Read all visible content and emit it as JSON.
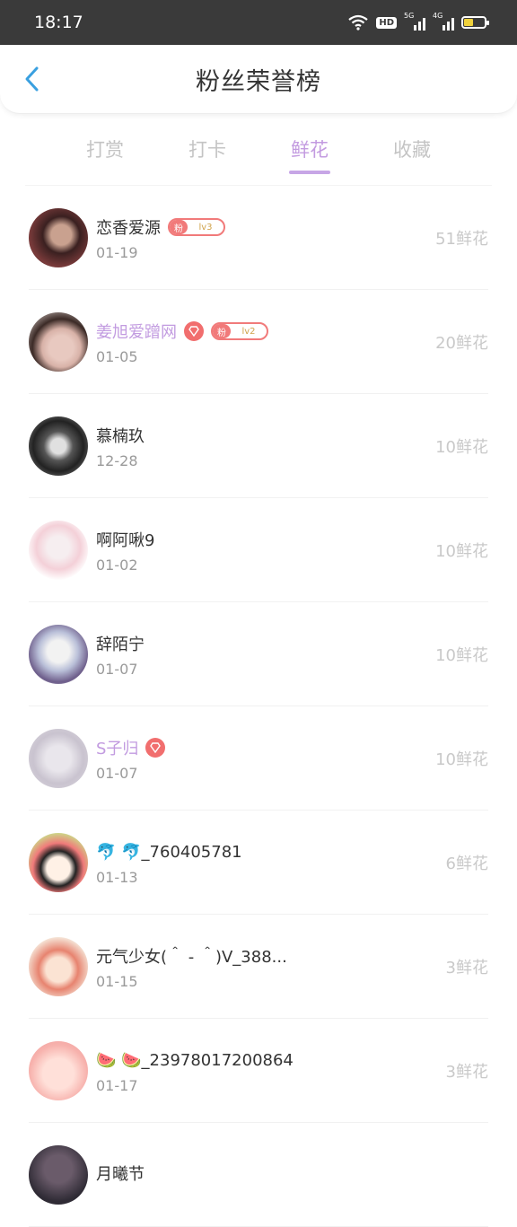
{
  "status": {
    "time": "18:17",
    "hd": "HD",
    "sig1": "5G",
    "sig2": "4G"
  },
  "header": {
    "title": "粉丝荣誉榜"
  },
  "tabs": [
    {
      "label": "打赏",
      "active": false
    },
    {
      "label": "打卡",
      "active": false
    },
    {
      "label": "鲜花",
      "active": true
    },
    {
      "label": "收藏",
      "active": false
    }
  ],
  "badge_prefix": "粉",
  "rows": [
    {
      "name": "恋香爱源",
      "date": "01-19",
      "count": "51鲜花",
      "vip": false,
      "level": "lv3"
    },
    {
      "name": "姜旭爱蹭网",
      "date": "01-05",
      "count": "20鲜花",
      "vip": true,
      "level": "lv2"
    },
    {
      "name": "慕楠玖",
      "date": "12-28",
      "count": "10鲜花",
      "vip": false,
      "level": ""
    },
    {
      "name": "啊阿啾9",
      "date": "01-02",
      "count": "10鲜花",
      "vip": false,
      "level": ""
    },
    {
      "name": "辞陌宁",
      "date": "01-07",
      "count": "10鲜花",
      "vip": false,
      "level": ""
    },
    {
      "name": "S子归",
      "date": "01-07",
      "count": "10鲜花",
      "vip": true,
      "level": ""
    },
    {
      "name": "🐬 🐬_760405781",
      "date": "01-13",
      "count": "6鲜花",
      "vip": false,
      "level": ""
    },
    {
      "name": "元气少女(＾ - ＾)V_388...",
      "date": "01-15",
      "count": "3鲜花",
      "vip": false,
      "level": ""
    },
    {
      "name": "🍉 🍉_23978017200864",
      "date": "01-17",
      "count": "3鲜花",
      "vip": false,
      "level": ""
    },
    {
      "name": "月曦节",
      "date": "",
      "count": "",
      "vip": false,
      "level": ""
    }
  ],
  "colors": {
    "accent": "#c39be0",
    "badge": "#f17a7a",
    "back": "#3aa0e0"
  }
}
